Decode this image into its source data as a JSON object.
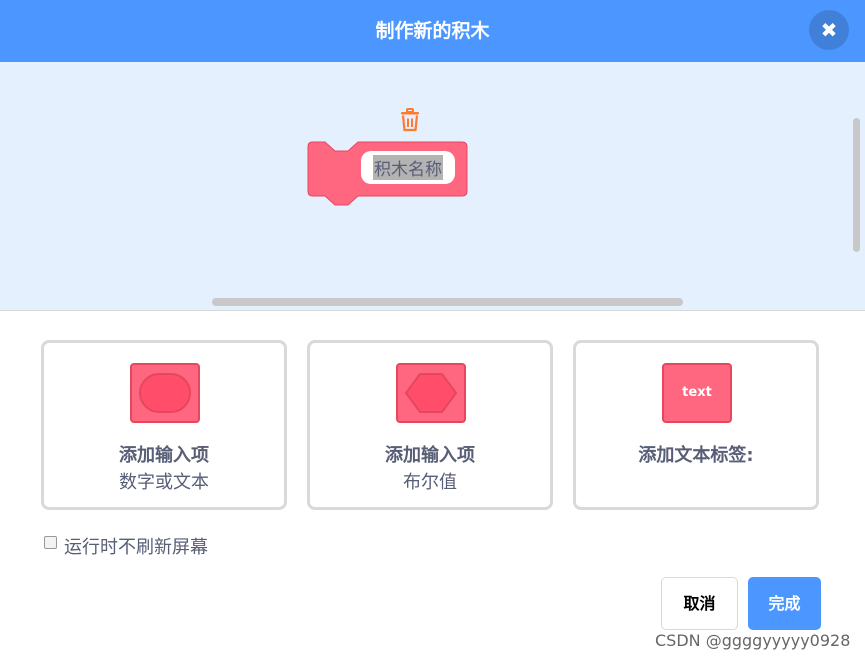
{
  "dialog": {
    "title": "制作新的积木",
    "close_icon": "close-icon",
    "accent_color": "#4c97ff"
  },
  "workspace": {
    "trash_icon": "trash-icon",
    "block": {
      "name_value": "积木名称",
      "color": "#ff6680"
    }
  },
  "options": [
    {
      "title": "添加输入项",
      "subtitle": "数字或文本",
      "icon": "rounded-input-icon"
    },
    {
      "title": "添加输入项",
      "subtitle": "布尔值",
      "icon": "boolean-input-icon"
    },
    {
      "title": "添加文本标签:",
      "icon": "text-label-icon",
      "icon_text": "text"
    }
  ],
  "run_without_refresh": {
    "label": "运行时不刷新屏幕",
    "checked": false
  },
  "buttons": {
    "cancel": "取消",
    "ok": "完成"
  },
  "watermark": "CSDN @ggggyyyyy0928"
}
